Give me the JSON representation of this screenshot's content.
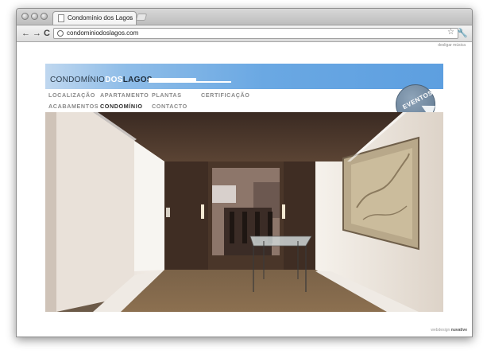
{
  "browser": {
    "tab_title": "Condomínio dos Lagos",
    "tab_close": "×",
    "url": "condominiodoslagos.com",
    "back": "←",
    "forward": "→",
    "reload": "C",
    "star": "☆",
    "wrench": "🔧"
  },
  "page": {
    "music_link": "desligar música",
    "logo_part1": "CONDOMÍNIO",
    "logo_part2": "DOS",
    "logo_part3": "LAGOS",
    "eventos": "EVENTOS",
    "nav": {
      "localizacao": "LOCALIZAÇÃO",
      "apartamento": "APARTAMENTO",
      "plantas": "PLANTAS",
      "certificacao": "CERTIFICAÇÃO",
      "acabamentos": "ACABAMENTOS",
      "condominio": "CONDOMÍNIO",
      "contacto": "CONTACTO"
    },
    "credit_webdesign": "webdesign",
    "credit_brand": "nuvative"
  },
  "colors": {
    "banner_blue": "#6aa8e3",
    "nav_gray": "#8a8a8a",
    "nav_active": "#2b2b2b"
  }
}
